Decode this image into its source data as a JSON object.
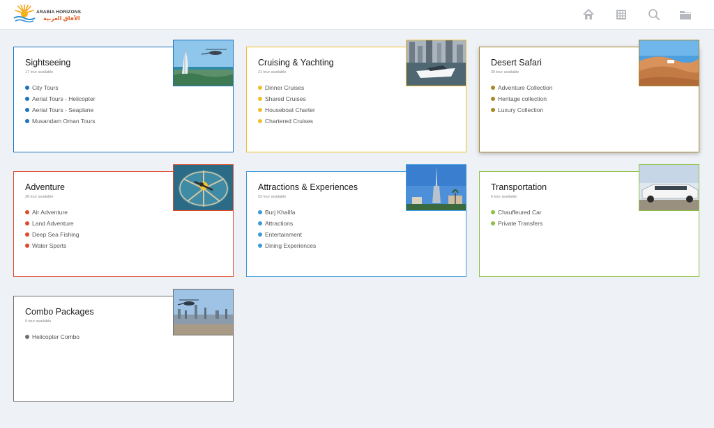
{
  "brand": {
    "name_en": "ARABIA HORIZONS",
    "name_ar": "الآفاق العربية"
  },
  "nav": {
    "icons": [
      "home-icon",
      "grid-icon",
      "search-icon",
      "folder-icon"
    ]
  },
  "colors": {
    "blue": "#1e72c0",
    "yellow": "#f0c02a",
    "gold": "#a8862a",
    "red": "#e04a2c",
    "light_blue": "#3d9ad8",
    "green": "#8dc042",
    "gray": "#6f6f6f"
  },
  "cards": [
    {
      "title": "Sightseeing",
      "count": "17 tour available",
      "items": [
        "City Tours",
        "Aerial Tours - Helicopter",
        "Aerial Tours - Seaplane",
        "Musandam Oman Tours"
      ],
      "image": "helicopter-burj-al-arab"
    },
    {
      "title": "Cruising & Yachting",
      "count": "21 tour available",
      "items": [
        "Dinner Cruises",
        "Shared Cruises",
        "Houseboat Charter",
        "Chartered Cruises"
      ],
      "image": "yacht-marina"
    },
    {
      "title": "Desert Safari",
      "count": "39 tour available",
      "items": [
        "Adventure Collection",
        "Heritage collection",
        "Luxury Collection"
      ],
      "image": "desert-dunes"
    },
    {
      "title": "Adventure",
      "count": "28 tour available",
      "items": [
        "Air Adventure",
        "Land Adventure",
        "Deep Sea Fishing",
        "Water Sports"
      ],
      "image": "skydiving-palm"
    },
    {
      "title": "Attractions & Experiences",
      "count": "53 tour available",
      "items": [
        "Burj Khalifa",
        "Attractions",
        "Entertainment",
        "Dining Experiences"
      ],
      "image": "burj-khalifa"
    },
    {
      "title": "Transportation",
      "count": "6 tour available",
      "items": [
        "Chauffeured Car",
        "Private Transfers"
      ],
      "image": "white-limousine"
    },
    {
      "title": "Combo Packages",
      "count": "9 tour available",
      "items": [
        "Helicopter Combo"
      ],
      "image": "helicopter-skyline"
    }
  ]
}
